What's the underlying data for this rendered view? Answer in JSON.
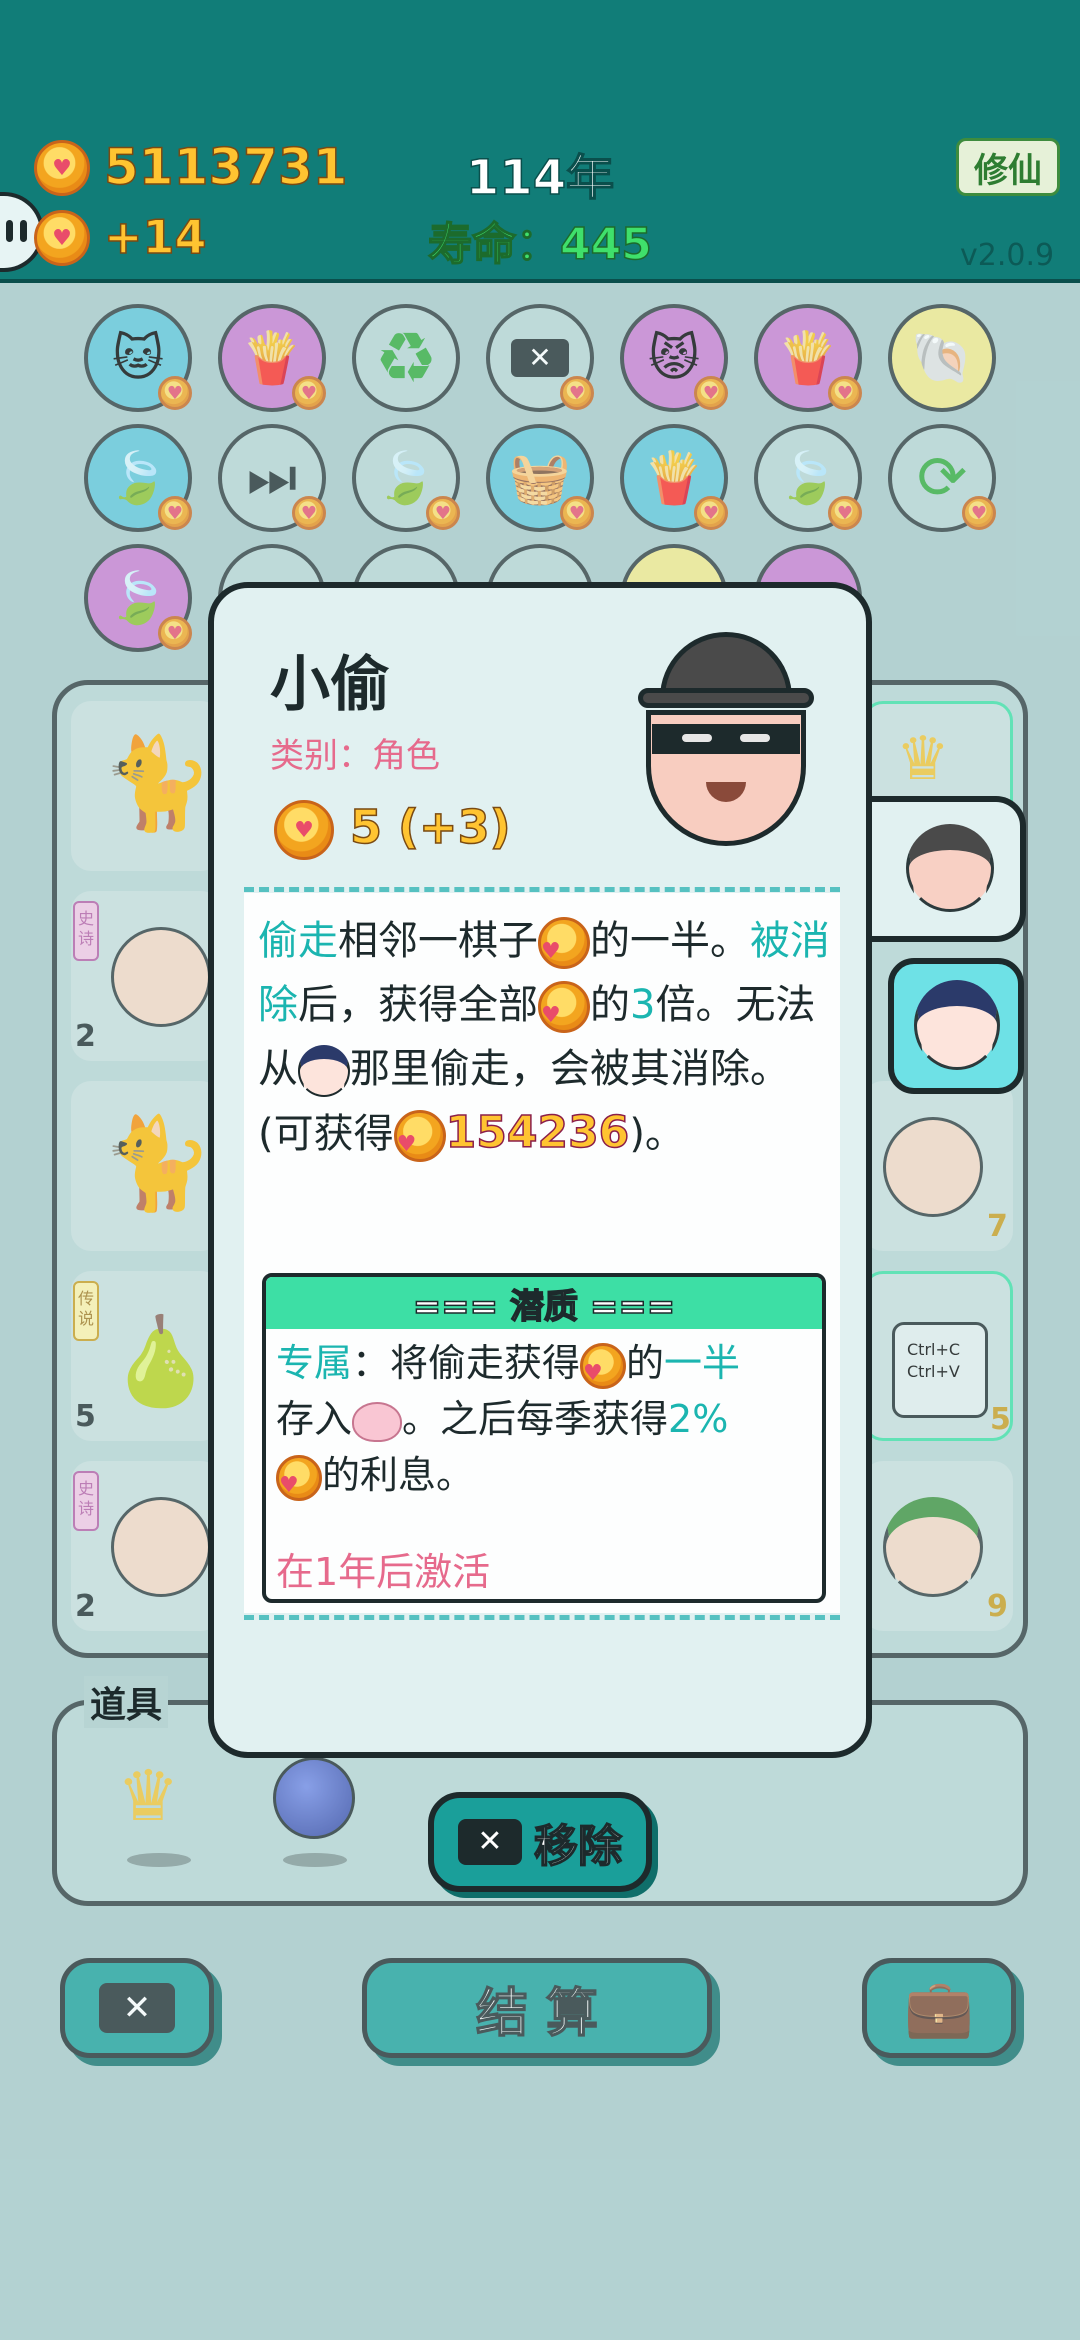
{
  "header": {
    "coins": "5113731",
    "income": "+14",
    "year": "114年",
    "lifespan": "寿命：445",
    "cultivate_label": "修仙",
    "version": "v2.0.9"
  },
  "item_rows": [
    [
      "cat-icon",
      "fries-icon",
      "recycle-icon",
      "delete-icon",
      "cats-icon",
      "fries-icon",
      "shell-icon"
    ],
    [
      "leaf-icon",
      "skip-icon",
      "leaf-icon",
      "basket-icon",
      "fries-icon",
      "leaf-icon",
      "refresh-icon"
    ],
    [
      "leaf-icon"
    ]
  ],
  "board": {
    "slot_counts": [
      "2",
      "5",
      "2",
      "7",
      "5",
      "9"
    ],
    "tag_epic": "史诗",
    "tag_legend": "传说",
    "ctrl_c": "Ctrl+C",
    "ctrl_v": "Ctrl+V"
  },
  "inventory": {
    "title": "道具"
  },
  "popup": {
    "name": "小偷",
    "category": "类别：角色",
    "value": "5 (+3)",
    "desc": {
      "steal": "偷走",
      "t1": "相邻一棋子",
      "t2": "的一半。",
      "eliminated": "被消除",
      "t3": "后，获得全部",
      "t4": "的",
      "times": "3",
      "t5": "倍。无法从",
      "t6": "那里偷走，会被其消除。",
      "t7": "(可获得",
      "amount": "154236",
      "t8": ")。"
    },
    "potential": {
      "title": "=== 潜质 ===",
      "exclusive": "专属",
      "p1": "：将偷走获得",
      "p2": "的",
      "half": "一半",
      "p3": "存入",
      "p4": "。之后每季获得",
      "rate": "2%",
      "p5": "的利息。",
      "activate": "在1年后激活"
    },
    "remove_label": "移除"
  },
  "footer": {
    "settle_label": "结 算"
  },
  "colors": {
    "topbar": "#117d78",
    "teal_text": "#1bb5b0",
    "pink_text": "#e66a8c",
    "potential_head": "#3ddfa5"
  }
}
